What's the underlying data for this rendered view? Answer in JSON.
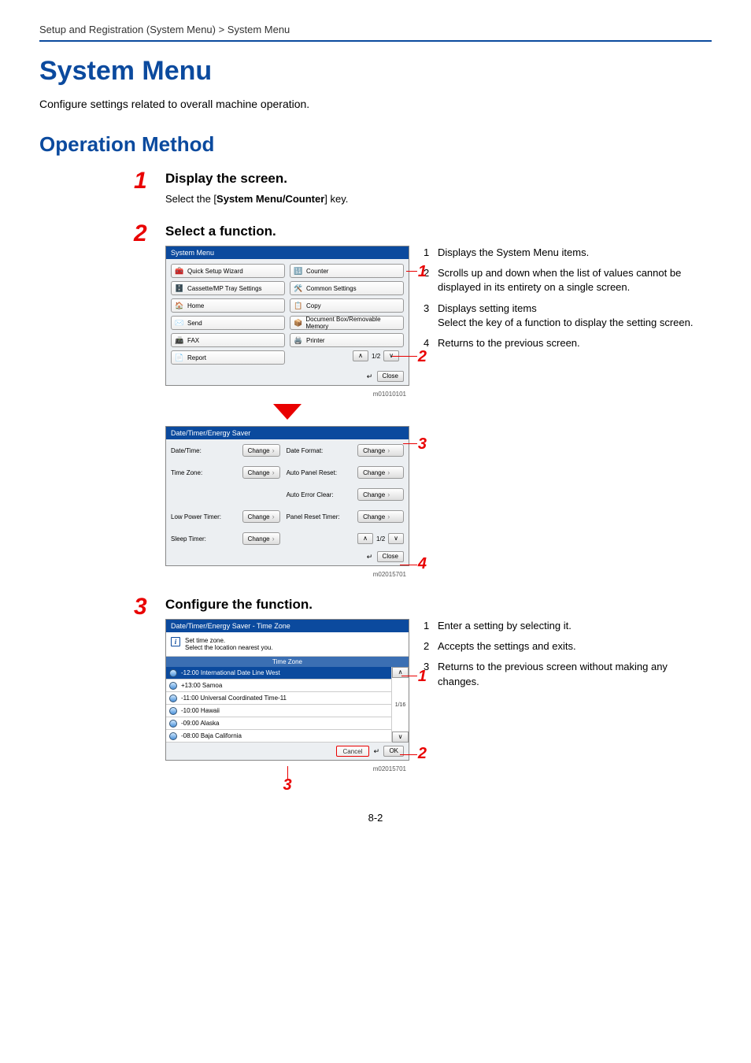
{
  "breadcrumb": "Setup and Registration (System Menu) > System Menu",
  "title": "System Menu",
  "intro": "Configure settings related to overall machine operation.",
  "section": "Operation Method",
  "steps": {
    "s1": {
      "num": "1",
      "heading": "Display the screen.",
      "text_pre": "Select the [",
      "text_bold": "System Menu/Counter",
      "text_post": "] key."
    },
    "s2": {
      "num": "2",
      "heading": "Select a function.",
      "panel1": {
        "title": "System Menu",
        "left": [
          "Quick Setup Wizard",
          "Cassette/MP Tray Settings",
          "Home",
          "Send",
          "FAX",
          "Report"
        ],
        "right": [
          "Counter",
          "Common Settings",
          "Copy",
          "Document Box/Removable Memory",
          "Printer"
        ],
        "page_ind": "1/2",
        "close": "Close",
        "code": "m01010101"
      },
      "panel2": {
        "title": "Date/Timer/Energy Saver",
        "rows": [
          [
            "Date/Time:",
            "Change",
            "Date Format:",
            "Change"
          ],
          [
            "Time Zone:",
            "Change",
            "Auto Panel Reset:",
            "Change"
          ],
          [
            "",
            "",
            "Auto Error Clear:",
            "Change"
          ],
          [
            "Low Power Timer:",
            "Change",
            "Panel Reset Timer:",
            "Change"
          ],
          [
            "Sleep Timer:",
            "Change",
            "",
            ""
          ]
        ],
        "page_ind": "1/2",
        "close": "Close",
        "code": "m02015701"
      },
      "legend": [
        {
          "n": "1",
          "t": "Displays the System Menu items."
        },
        {
          "n": "2",
          "t": "Scrolls up and down when the list of values cannot be displayed in its entirety on a single screen."
        },
        {
          "n": "3",
          "t": "Displays setting items",
          "t2": "Select the key of a function to display the setting screen."
        },
        {
          "n": "4",
          "t": "Returns to the previous screen."
        }
      ]
    },
    "s3": {
      "num": "3",
      "heading": "Configure the function.",
      "panel3": {
        "title": "Date/Timer/Energy Saver - Time Zone",
        "info1": "Set time zone.",
        "info2": "Select the location nearest you.",
        "listhdr": "Time Zone",
        "rows": [
          "-12:00 International Date Line West",
          "+13:00 Samoa",
          "-11:00 Universal Coordinated Time-11",
          "-10:00 Hawaii",
          "-09:00 Alaska",
          "-08:00 Baja California"
        ],
        "page_ind": "1/16",
        "cancel": "Cancel",
        "ok": "OK",
        "code": "m02015701"
      },
      "legend": [
        {
          "n": "1",
          "t": "Enter a setting by selecting it."
        },
        {
          "n": "2",
          "t": "Accepts the settings and exits."
        },
        {
          "n": "3",
          "t": "Returns to the previous screen without making any changes."
        }
      ]
    }
  },
  "page_num": "8-2"
}
